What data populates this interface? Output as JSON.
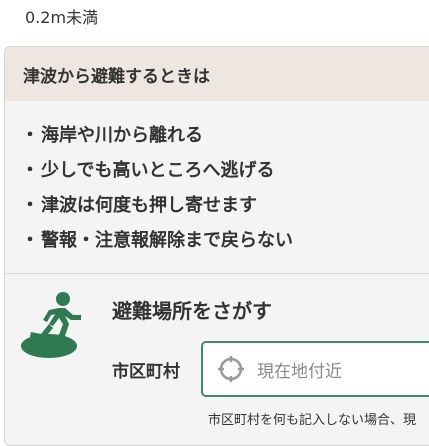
{
  "top": {
    "value_text": "0.2m未満"
  },
  "panel": {
    "header": "津波から避難するときは",
    "tips": [
      "海岸や川から離れる",
      "少しでも高いところへ逃げる",
      "津波は何度も押し寄せます",
      "警報・注意報解除まで戻らない"
    ],
    "bullet": "・"
  },
  "search": {
    "title": "避難場所をさがす",
    "municipality_label": "市区町村",
    "input_placeholder": "現在地付近",
    "note": "市区町村を何も記入しない場合、現"
  },
  "colors": {
    "accent_green": "#2f7a50",
    "input_border": "#3f8b63",
    "header_bg": "#eee6e0",
    "panel_bg": "#f4f4f4"
  },
  "icons": {
    "evacuation": "running-person-icon",
    "location": "location-target-icon"
  }
}
